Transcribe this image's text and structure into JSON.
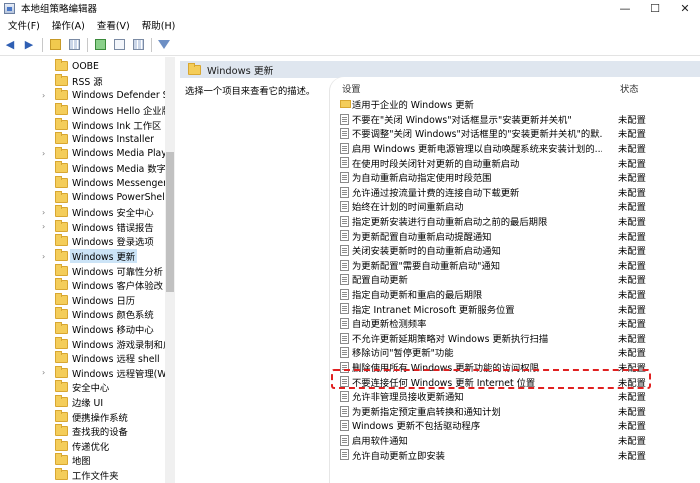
{
  "window": {
    "title": "本地组策略编辑器",
    "minimize": "—",
    "maximize": "☐",
    "close": "✕"
  },
  "menu": [
    "文件(F)",
    "操作(A)",
    "查看(V)",
    "帮助(H)"
  ],
  "tree": {
    "items": [
      {
        "label": "OOBE",
        "chevron": false
      },
      {
        "label": "RSS 源",
        "chevron": false
      },
      {
        "label": "Windows Defender Sr",
        "chevron": true
      },
      {
        "label": "Windows Hello 企业版",
        "chevron": false
      },
      {
        "label": "Windows Ink 工作区",
        "chevron": false
      },
      {
        "label": "Windows Installer",
        "chevron": false
      },
      {
        "label": "Windows Media Playe",
        "chevron": true
      },
      {
        "label": "Windows Media 数字",
        "chevron": false
      },
      {
        "label": "Windows Messenger",
        "chevron": false
      },
      {
        "label": "Windows PowerShell",
        "chevron": false
      },
      {
        "label": "Windows 安全中心",
        "chevron": true
      },
      {
        "label": "Windows 错误报告",
        "chevron": true
      },
      {
        "label": "Windows 登录选项",
        "chevron": false
      },
      {
        "label": "Windows 更新",
        "chevron": true,
        "selected": true
      },
      {
        "label": "Windows 可靠性分析",
        "chevron": false
      },
      {
        "label": "Windows 客户体验改",
        "chevron": false
      },
      {
        "label": "Windows 日历",
        "chevron": false
      },
      {
        "label": "Windows 颜色系统",
        "chevron": false
      },
      {
        "label": "Windows 移动中心",
        "chevron": false
      },
      {
        "label": "Windows 游戏录制和广",
        "chevron": false
      },
      {
        "label": "Windows 远程 shell",
        "chevron": false
      },
      {
        "label": "Windows 远程管理(Wi",
        "chevron": true
      },
      {
        "label": "安全中心",
        "chevron": false
      },
      {
        "label": "边缘 UI",
        "chevron": false
      },
      {
        "label": "便携操作系统",
        "chevron": false
      },
      {
        "label": "查找我的设备",
        "chevron": false
      },
      {
        "label": "传递优化",
        "chevron": false
      },
      {
        "label": "地图",
        "chevron": false
      },
      {
        "label": "工作文件夹",
        "chevron": false
      }
    ]
  },
  "pane": {
    "title": "Windows 更新",
    "description": "选择一个项目来查看它的描述。",
    "col_setting": "设置",
    "col_state": "状态",
    "rows": [
      {
        "label": "适用于企业的 Windows 更新",
        "state": "",
        "kind": "folder"
      },
      {
        "label": "不要在\"关闭 Windows\"对话框显示\"安装更新并关机\"",
        "state": "未配置"
      },
      {
        "label": "不要调整\"关闭 Windows\"对话框里的\"安装更新并关机\"的默...",
        "state": "未配置"
      },
      {
        "label": "启用 Windows 更新电源管理以自动唤醒系统来安装计划的...",
        "state": "未配置"
      },
      {
        "label": "在使用时段关闭针对更新的自动重新启动",
        "state": "未配置"
      },
      {
        "label": "为自动重新启动指定使用时段范围",
        "state": "未配置"
      },
      {
        "label": "允许通过按流量计费的连接自动下载更新",
        "state": "未配置"
      },
      {
        "label": "始终在计划的时间重新启动",
        "state": "未配置"
      },
      {
        "label": "指定更新安装进行自动重新启动之前的最后期限",
        "state": "未配置"
      },
      {
        "label": "为更新配置自动重新启动提醒通知",
        "state": "未配置"
      },
      {
        "label": "关闭安装更新时的自动重新启动通知",
        "state": "未配置"
      },
      {
        "label": "为更新配置\"需要自动重新启动\"通知",
        "state": "未配置"
      },
      {
        "label": "配置自动更新",
        "state": "未配置"
      },
      {
        "label": "指定自动更新和重启的最后期限",
        "state": "未配置"
      },
      {
        "label": "指定 Intranet Microsoft 更新服务位置",
        "state": "未配置"
      },
      {
        "label": "自动更新检测频率",
        "state": "未配置"
      },
      {
        "label": "不允许更新延期策略对 Windows 更新执行扫描",
        "state": "未配置"
      },
      {
        "label": "移除访问\"暂停更新\"功能",
        "state": "未配置"
      },
      {
        "label": "删除使用所有 Windows 更新功能的访问权限",
        "state": "未配置",
        "highlight": true
      },
      {
        "label": "不要连接任何 Windows 更新 Internet 位置",
        "state": "未配置"
      },
      {
        "label": "允许非管理员接收更新通知",
        "state": "未配置"
      },
      {
        "label": "为更新指定预定重启转换和通知计划",
        "state": "未配置"
      },
      {
        "label": "Windows 更新不包括驱动程序",
        "state": "未配置"
      },
      {
        "label": "启用软件通知",
        "state": "未配置"
      },
      {
        "label": "允许自动更新立即安装",
        "state": "未配置"
      }
    ]
  },
  "colors": {
    "selected": "#cce4f7",
    "header": "#dfe6ef",
    "highlight": "#e02020"
  }
}
